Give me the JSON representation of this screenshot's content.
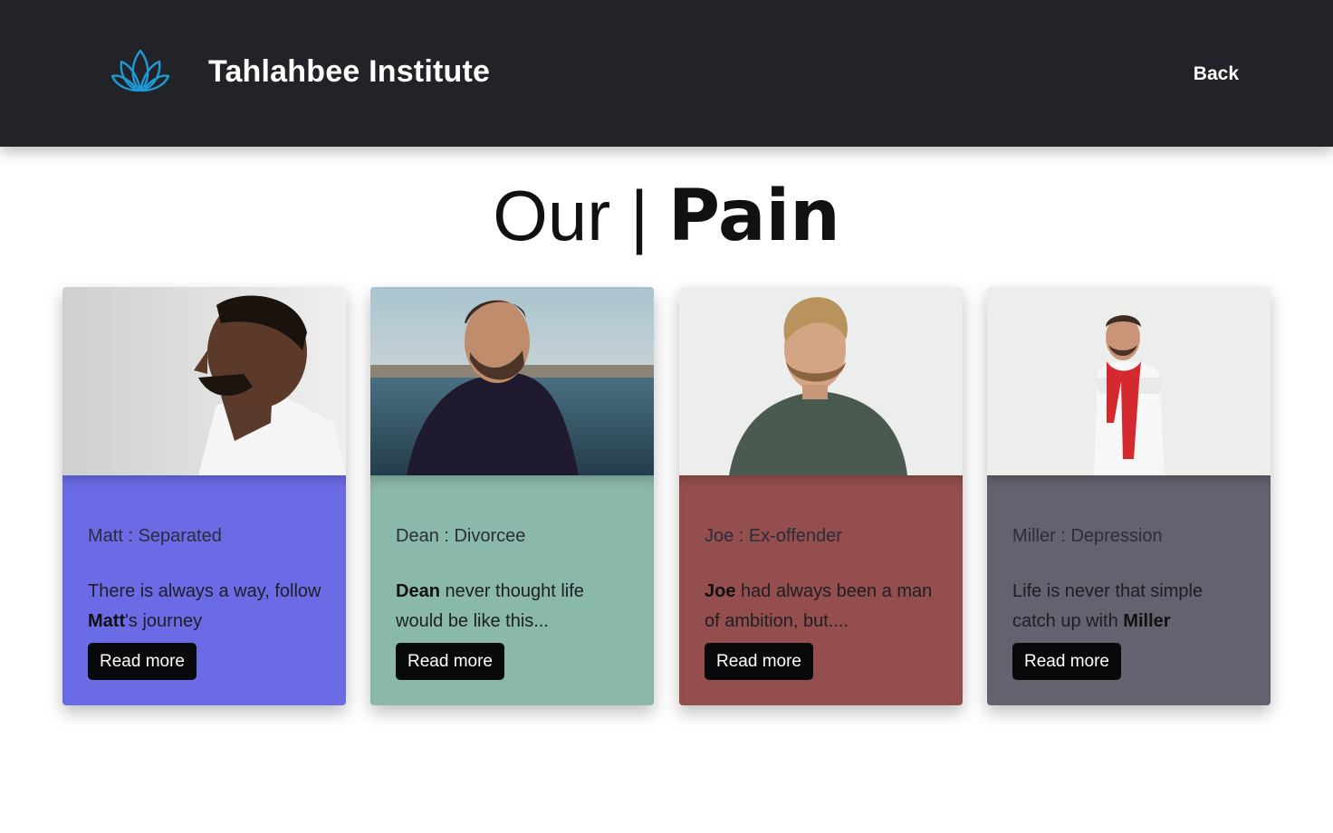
{
  "navbar": {
    "brand": "Tahlahbee Institute",
    "back_label": "Back",
    "bg_color": "#212328",
    "logo_icon": "lotus-icon",
    "logo_color": "#1e9ad6"
  },
  "heading": {
    "light": "Our",
    "separator": "|",
    "bold": "Pain"
  },
  "cards": [
    {
      "name_label": "Matt : Separated",
      "text_before": "There is always a way, follow ",
      "text_bold": "Matt",
      "text_after": "'s journey",
      "button_label": "Read more",
      "color": "#6b6be6"
    },
    {
      "name_label": "Dean : Divorcee",
      "text_before": "",
      "text_bold": "Dean",
      "text_after": " never thought life would be like this...",
      "button_label": "Read more",
      "color": "#8ab8ab"
    },
    {
      "name_label": "Joe : Ex-offender",
      "text_before": "",
      "text_bold": "Joe",
      "text_after": " had always been a man of ambition, but....",
      "button_label": "Read more",
      "color": "#944e4d"
    },
    {
      "name_label": "Miller : Depression",
      "text_before": "Life is never that simple catch up with ",
      "text_bold": "Miller",
      "text_after": "",
      "button_label": "Read more",
      "color": "#62636e"
    }
  ]
}
